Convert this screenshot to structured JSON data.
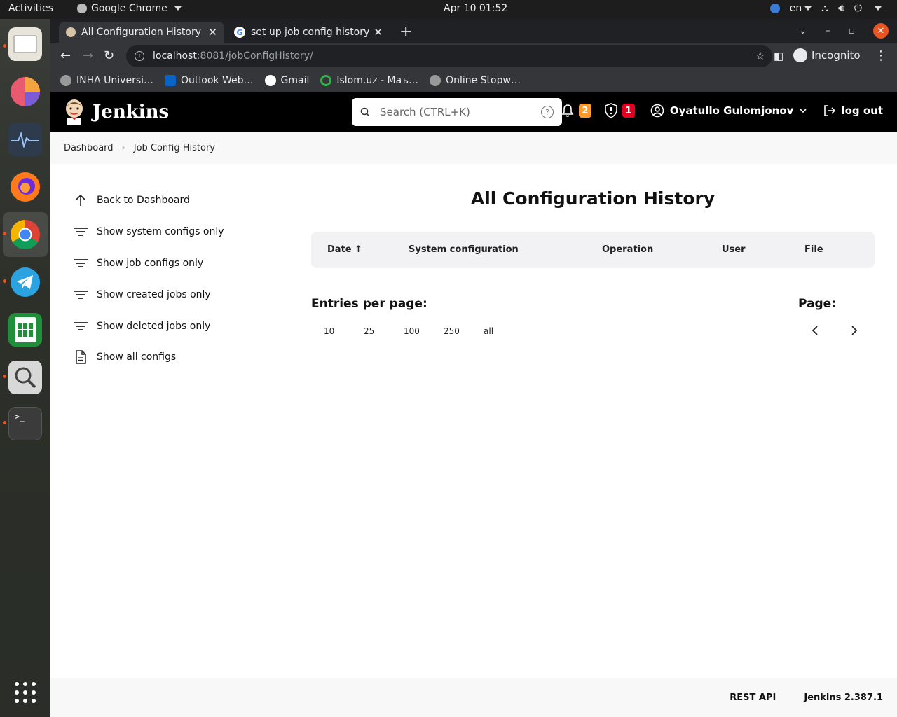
{
  "system": {
    "activities": "Activities",
    "app_name": "Google Chrome",
    "clock": "Apr 10  01:52",
    "language": "en"
  },
  "browser": {
    "tabs": [
      {
        "title": "All Configuration History",
        "active": true
      },
      {
        "title": "set up job config history i",
        "active": false
      }
    ],
    "url_host": "localhost",
    "url_path": ":8081/jobConfigHistory/",
    "incognito_label": "Incognito",
    "bookmarks": [
      {
        "label": "INHA Universi…",
        "icon": "globe-icon"
      },
      {
        "label": "Outlook Web…",
        "icon": "outlook-icon"
      },
      {
        "label": "Gmail",
        "icon": "google-icon"
      },
      {
        "label": "Islom.uz - Маъ…",
        "icon": "islom-icon"
      },
      {
        "label": "Online Stopw…",
        "icon": "globe-icon"
      }
    ]
  },
  "jenkins": {
    "logo_title": "Jenkins",
    "search_placeholder": "Search (CTRL+K)",
    "notifications_count": "2",
    "security_count": "1",
    "user_name": "Oyatullo Gulomjonov",
    "logout_label": "log out",
    "breadcrumb": [
      "Dashboard",
      "Job Config History"
    ],
    "side_items": [
      {
        "label": "Back to Dashboard",
        "icon": "arrow-up-icon"
      },
      {
        "label": "Show system configs only",
        "icon": "filter-icon"
      },
      {
        "label": "Show job configs only",
        "icon": "filter-icon"
      },
      {
        "label": "Show created jobs only",
        "icon": "filter-icon"
      },
      {
        "label": "Show deleted jobs only",
        "icon": "filter-icon"
      },
      {
        "label": "Show all configs",
        "icon": "document-icon"
      }
    ],
    "page_title": "All Configuration History",
    "table_headers": [
      "Date ↑",
      "System configuration",
      "Operation",
      "User",
      "File"
    ],
    "entries_label": "Entries per page:",
    "entries_options": [
      "10",
      "25",
      "100",
      "250",
      "all"
    ],
    "page_label": "Page:",
    "footer": {
      "rest_api": "REST API",
      "version": "Jenkins 2.387.1"
    }
  }
}
